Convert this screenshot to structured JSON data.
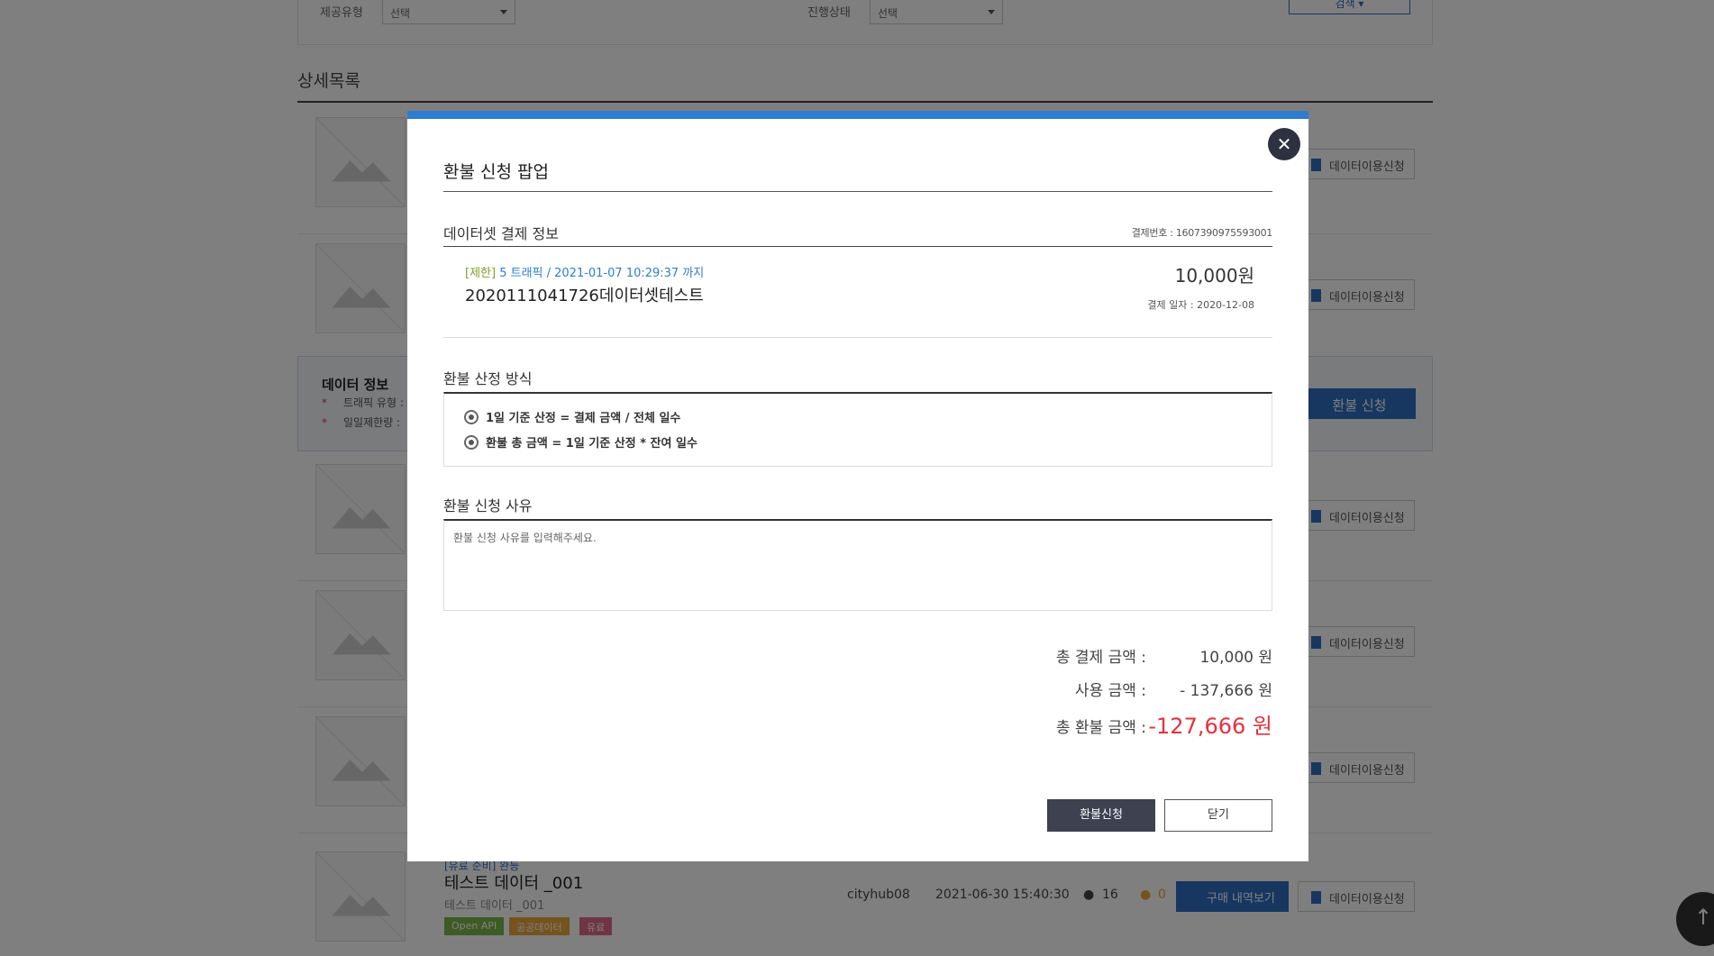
{
  "background": {
    "filter": {
      "type_label": "제공유형",
      "type_value": "선택",
      "status_label": "진행상태",
      "status_value": "선택",
      "search_label": "검색 ▾"
    },
    "section_title": "상세목록",
    "use_button_label": "데이터이용신청",
    "info_box": {
      "title": "데이터 정보",
      "item1": "트래픽 유형 :",
      "item2": "일일제한량 :",
      "refund_button": "환불 신청"
    },
    "last_item": {
      "top_label": "[유료 준비] 완등",
      "title": "테스트 데이터 _001",
      "subtitle": "테스트 데이터 _001",
      "tags": [
        "Open API",
        "공공데이터",
        "유료"
      ],
      "user": "cityhub08",
      "datetime": "2021-06-30 15:40:30",
      "views": "16",
      "likes": "0",
      "buy_button": "구매 내역보기"
    }
  },
  "modal": {
    "title": "환불 신청 팝업",
    "payment_section_title": "데이터셋 결제 정보",
    "payment_number": "결제번호 : 1607390975593001",
    "item": {
      "limit_tag": "[제한]",
      "traffic_info": " 5 트래픽 / 2021-01-07 10:29:37 까지",
      "name": "2020111041726데이터셋테스트",
      "price": "10,000원",
      "pay_date": "결제 일자 : 2020-12-08"
    },
    "method_section_title": "환불 산정 방식",
    "methods": [
      "1일 기준 산정 = 결제 금액 / 전체 일수",
      "환불 총 금액 = 1일 기준 산정 * 잔여 일수"
    ],
    "reason_section_title": "환불 신청 사유",
    "reason_placeholder": "환불 신청 사유를 입력해주세요.",
    "summary": {
      "total_pay_label": "총 결제 금액 :",
      "total_pay_value": "10,000 원",
      "used_label": "사용 금액 :",
      "used_value": "- 137,666 원",
      "refund_label": "총 환불 금액 :",
      "refund_value": "-127,666 원"
    },
    "apply_button": "환불신청",
    "close_button": "닫기"
  },
  "colors": {
    "modal_accent": "#2e7cd0",
    "refund_total": "#e8313b",
    "primary_button": "#3d4150"
  }
}
